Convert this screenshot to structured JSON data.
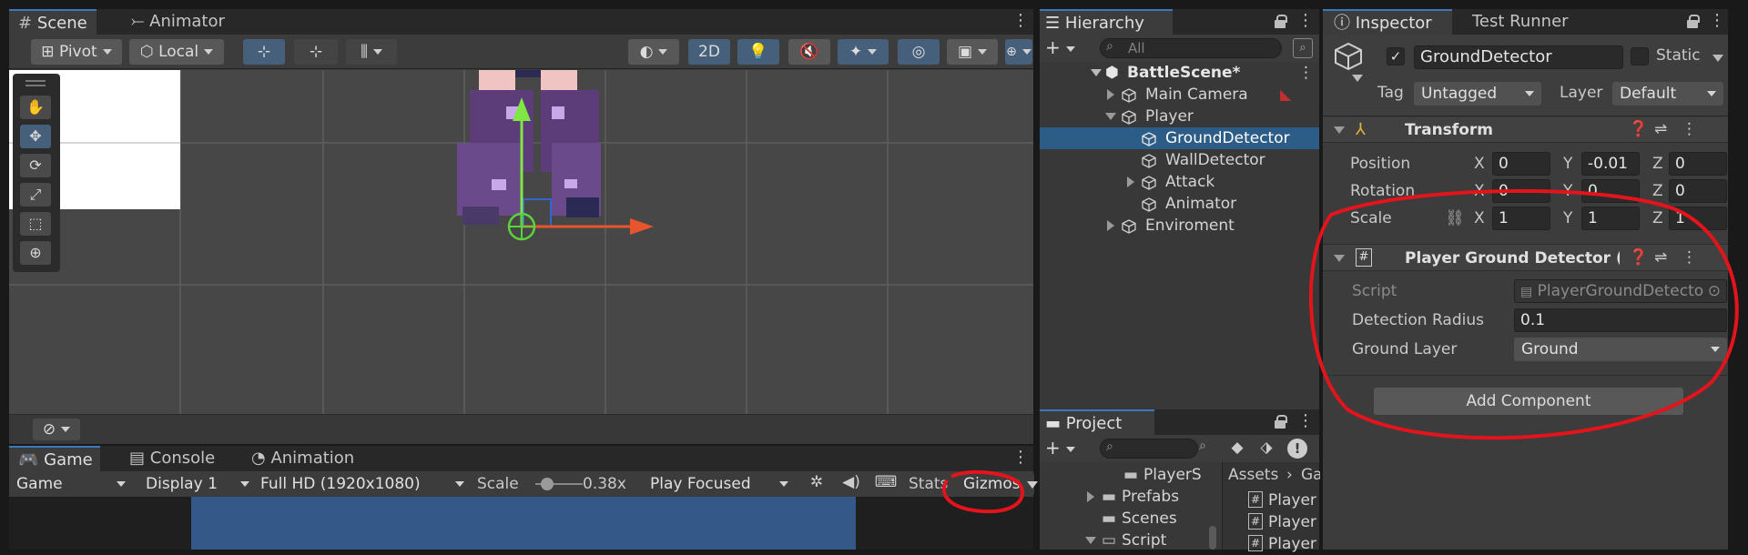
{
  "scene_panel": {
    "tabs": [
      {
        "label": "Scene"
      },
      {
        "label": "Animator"
      }
    ],
    "toolbar": {
      "pivot": "Pivot",
      "local": "Local",
      "mode_2d": "2D"
    }
  },
  "game_panel": {
    "tabs": [
      {
        "label": "Game"
      },
      {
        "label": "Console"
      },
      {
        "label": "Animation"
      }
    ],
    "toolbar": {
      "game": "Game",
      "display": "Display 1",
      "resolution": "Full HD (1920x1080)",
      "scale_label": "Scale",
      "scale_value": "0.38x",
      "play_focused": "Play Focused",
      "stats": "Stats",
      "gizmos": "Gizmos"
    }
  },
  "hierarchy": {
    "tab": "Hierarchy",
    "search_placeholder": "All",
    "scene_name": "BattleScene*",
    "items": [
      {
        "label": "Main Camera"
      },
      {
        "label": "Player"
      },
      {
        "label": "GroundDetector"
      },
      {
        "label": "WallDetector"
      },
      {
        "label": "Attack"
      },
      {
        "label": "Animator"
      },
      {
        "label": "Enviroment"
      }
    ]
  },
  "project": {
    "tab": "Project",
    "breadcrumb": {
      "root": "Assets",
      "next": "Ga"
    },
    "folders": [
      {
        "label": "PlayerS"
      },
      {
        "label": "Prefabs"
      },
      {
        "label": "Scenes"
      },
      {
        "label": "Script"
      }
    ],
    "files": [
      {
        "label": "Player"
      },
      {
        "label": "Player"
      },
      {
        "label": "Player"
      }
    ]
  },
  "inspector": {
    "tabs": [
      {
        "label": "Inspector"
      },
      {
        "label": "Test Runner"
      }
    ],
    "object_name": "GroundDetector",
    "static_label": "Static",
    "tag_label": "Tag",
    "tag_value": "Untagged",
    "layer_label": "Layer",
    "layer_value": "Default",
    "transform": {
      "title": "Transform",
      "position": {
        "label": "Position",
        "x": "0",
        "y": "-0.01",
        "z": "0"
      },
      "rotation": {
        "label": "Rotation",
        "x": "0",
        "y": "0",
        "z": "0"
      },
      "scale": {
        "label": "Scale",
        "x": "1",
        "y": "1",
        "z": "1"
      }
    },
    "script_component": {
      "title": "Player Ground Detector (Scri",
      "script_label": "Script",
      "script_value": "PlayerGroundDetecto",
      "radius_label": "Detection Radius",
      "radius_value": "0.1",
      "layer_label": "Ground Layer",
      "layer_value": "Ground"
    },
    "add_component": "Add Component"
  },
  "colors": {
    "annotation": "#e3141b",
    "selection": "#2c5d87",
    "accent": "#3a79bb"
  }
}
